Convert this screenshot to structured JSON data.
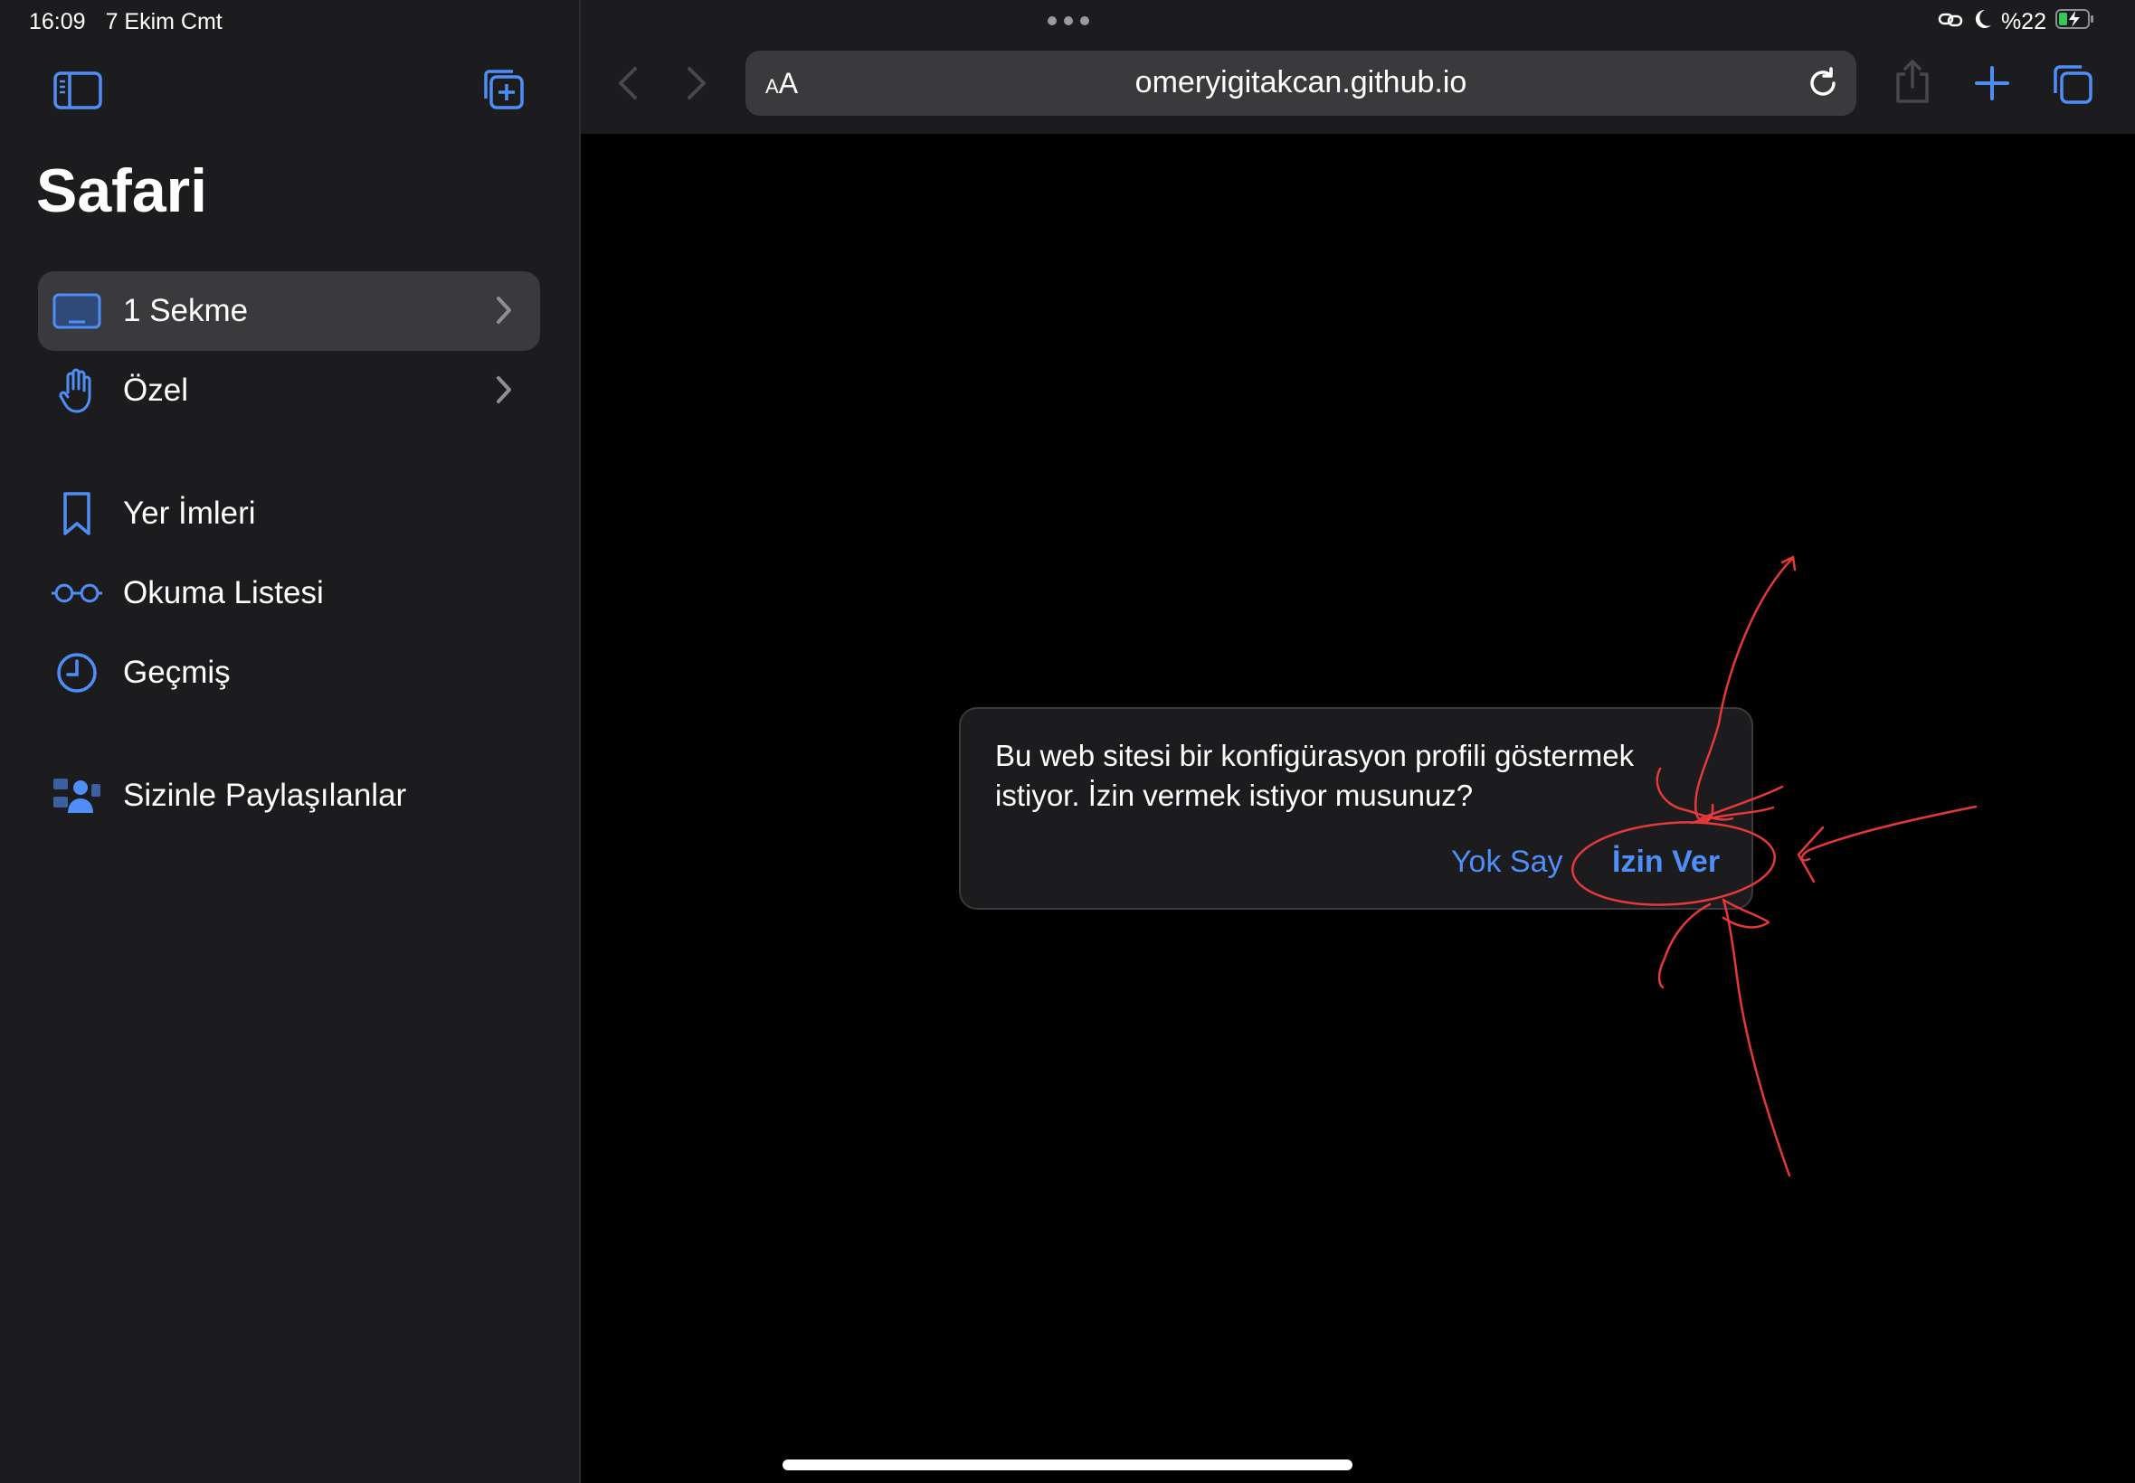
{
  "status_bar": {
    "time": "16:09",
    "date": "7 Ekim Cmt",
    "battery": "%22",
    "icons": [
      "link-icon",
      "moon-icon",
      "battery-charging-icon"
    ]
  },
  "sidebar": {
    "title": "Safari",
    "items": [
      {
        "label": "1 Sekme",
        "icon": "tab-icon",
        "selected": true,
        "chevron": true
      },
      {
        "label": "Özel",
        "icon": "hand-icon",
        "chevron": true
      },
      {
        "label": "Yer İmleri",
        "icon": "bookmark-icon"
      },
      {
        "label": "Okuma Listesi",
        "icon": "glasses-icon"
      },
      {
        "label": "Geçmiş",
        "icon": "clock-icon"
      },
      {
        "label": "Sizinle Paylaşılanlar",
        "icon": "shared-people-icon"
      }
    ]
  },
  "toolbar": {
    "url": "omeryigitakcan.github.io",
    "reader_label_small": "A",
    "reader_label_big": "A"
  },
  "dialog": {
    "message": "Bu web sitesi bir konfigürasyon profili göstermek istiyor. İzin vermek istiyor musunuz?",
    "ignore_label": "Yok Say",
    "allow_label": "İzin Ver"
  },
  "colors": {
    "accent": "#4f8ef7",
    "sidebar_bg": "#1c1c1e",
    "selected_bg": "#3a3a3c",
    "annotation": "#e5383b"
  }
}
